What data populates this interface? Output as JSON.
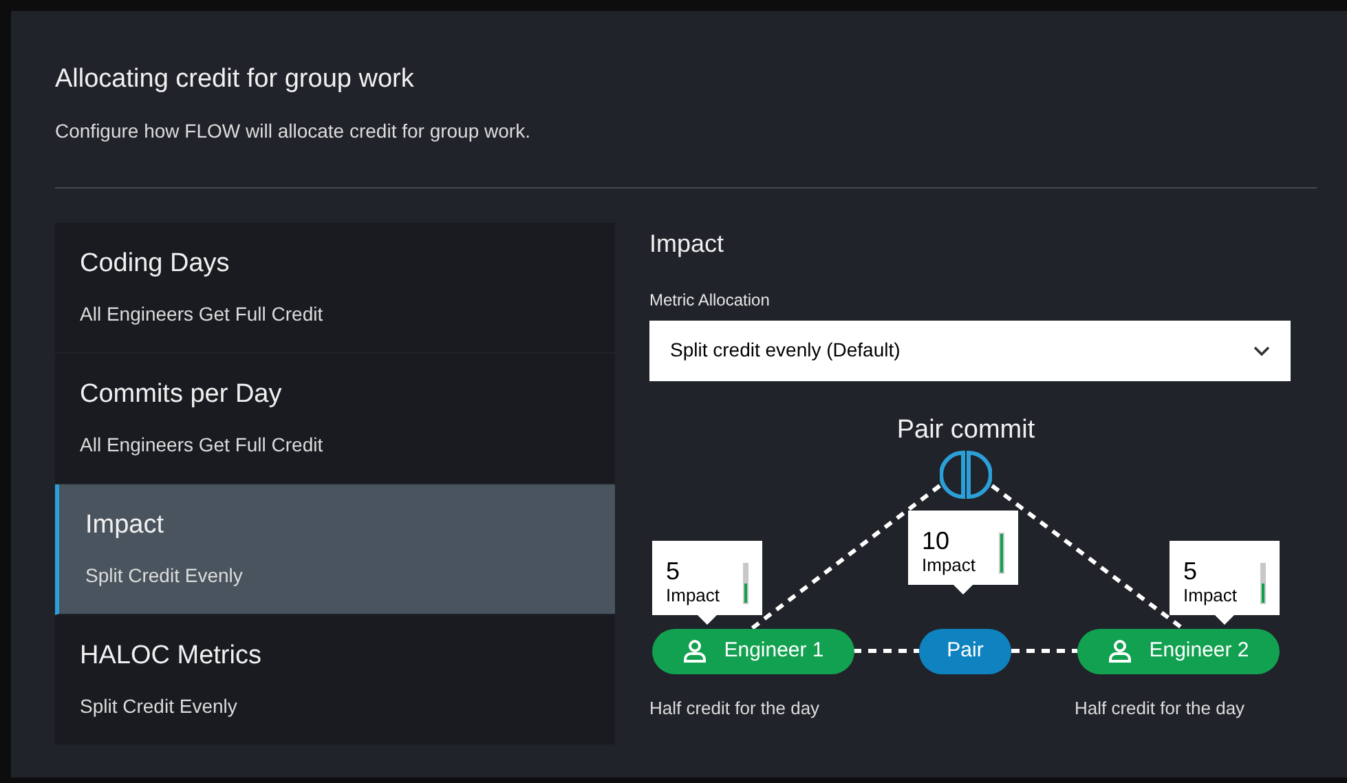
{
  "header": {
    "title": "Allocating credit for group work",
    "subtitle": "Configure how FLOW will allocate credit for group work."
  },
  "metrics": [
    {
      "name": "Coding Days",
      "allocation": "All Engineers Get Full Credit",
      "selected": false
    },
    {
      "name": "Commits per Day",
      "allocation": "All Engineers Get Full Credit",
      "selected": false
    },
    {
      "name": "Impact",
      "allocation": "Split Credit Evenly",
      "selected": true
    },
    {
      "name": "HALOC Metrics",
      "allocation": "Split Credit Evenly",
      "selected": false
    }
  ],
  "detail": {
    "title": "Impact",
    "field_label": "Metric Allocation",
    "dropdown": {
      "value": "Split credit evenly (Default)"
    },
    "diagram": {
      "title": "Pair commit",
      "commit": {
        "value": "10",
        "label": "Impact",
        "level": 1
      },
      "pair": {
        "label": "Pair"
      },
      "engineers": [
        {
          "name": "Engineer 1",
          "value": "5",
          "label": "Impact",
          "level": 0.5,
          "note": "Half credit for the day"
        },
        {
          "name": "Engineer 2",
          "value": "5",
          "label": "Impact",
          "level": 0.5,
          "note": "Half credit for the day"
        }
      ]
    }
  }
}
